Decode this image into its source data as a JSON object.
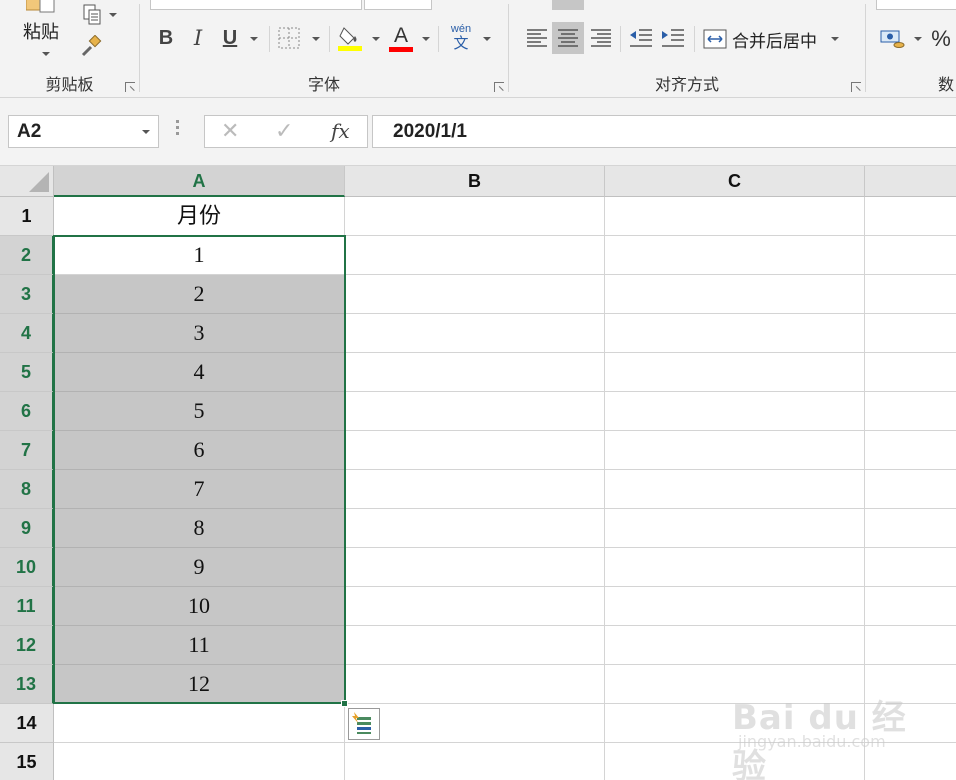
{
  "ribbon": {
    "clipboard": {
      "paste_label": "粘贴",
      "group_label": "剪贴板"
    },
    "font": {
      "bold_label": "B",
      "italic_label": "I",
      "underline_label": "U",
      "font_color_glyph": "A",
      "phonetic_top": "wén",
      "phonetic_bottom": "文",
      "group_label": "字体",
      "highlight_color": "#ffff00",
      "font_color": "#ff0000"
    },
    "alignment": {
      "merge_label": "合并后居中",
      "group_label": "对齐方式"
    },
    "number": {
      "percent_label": "%",
      "group_label_partial": "数"
    }
  },
  "formula_bar": {
    "name_box": "A2",
    "fx_label": "fx",
    "formula": "2020/1/1"
  },
  "grid": {
    "columns": [
      "A",
      "B",
      "C"
    ],
    "rows": [
      "1",
      "2",
      "3",
      "4",
      "5",
      "6",
      "7",
      "8",
      "9",
      "10",
      "11",
      "12",
      "13",
      "14",
      "15"
    ],
    "cells_a": [
      "月份",
      "1",
      "2",
      "3",
      "4",
      "5",
      "6",
      "7",
      "8",
      "9",
      "10",
      "11",
      "12",
      "",
      ""
    ],
    "selected_column": "A",
    "selected_range": "A2:A13",
    "accent_color": "#217346"
  },
  "watermark": {
    "brand": "Bai du 经验",
    "url": "jingyan.baidu.com"
  }
}
